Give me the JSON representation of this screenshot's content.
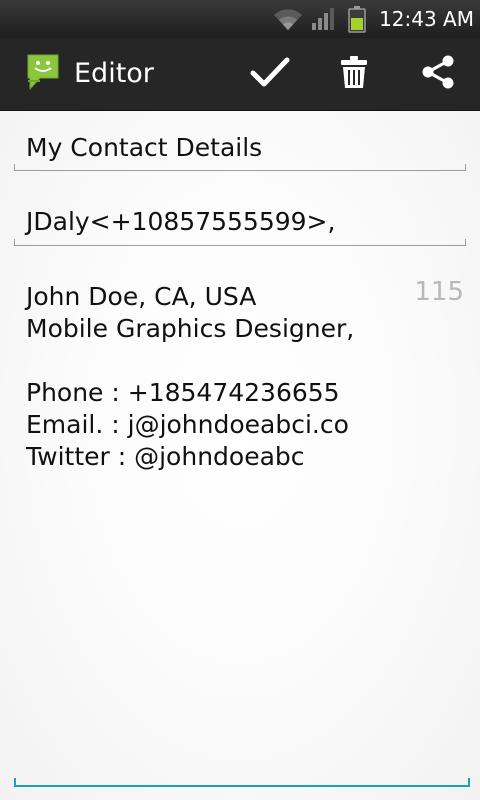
{
  "status_bar": {
    "time": "12:43 AM",
    "icons": [
      "wifi-icon",
      "signal-icon",
      "battery-icon"
    ]
  },
  "action_bar": {
    "title": "Editor",
    "actions": [
      "check-icon",
      "trash-icon",
      "share-icon"
    ]
  },
  "form": {
    "subject": "My Contact Details",
    "recipients": "JDaly<+10857555599>,",
    "char_counter": "115",
    "body_lines": [
      "John Doe, CA, USA",
      "Mobile Graphics Designer,",
      "",
      "Phone : +185474236655",
      "Email. : j@johndoeabci.co",
      "Twitter : @johndoeabc"
    ]
  },
  "colors": {
    "accent": "#1aa1b9",
    "app_icon": "#8cc63f",
    "action_bar": "#262626"
  }
}
